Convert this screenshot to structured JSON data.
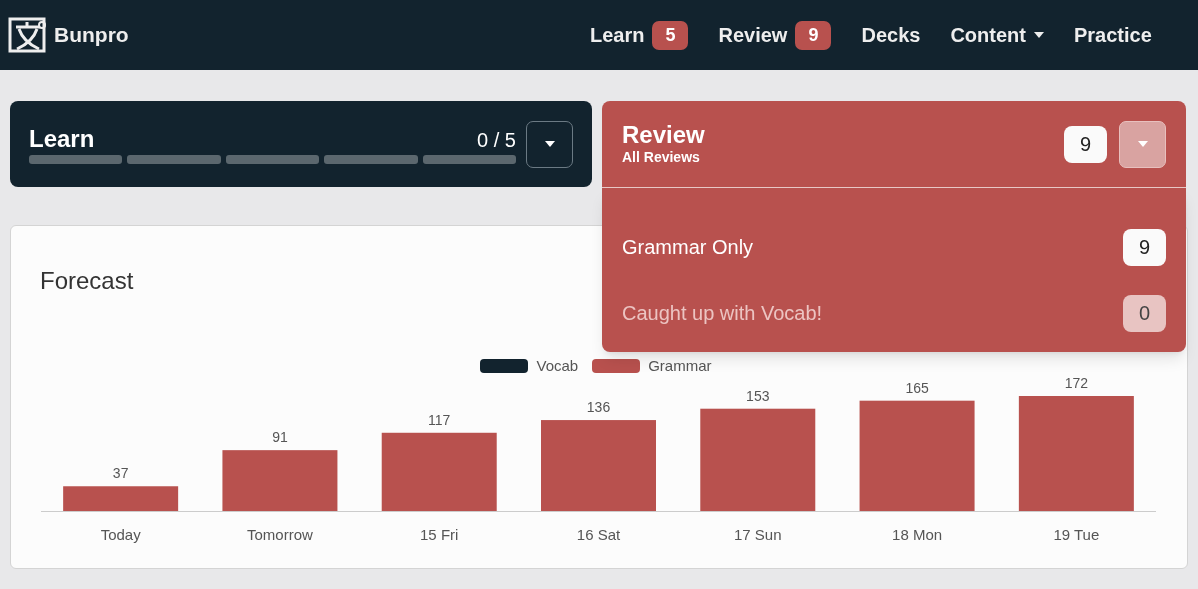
{
  "navbar": {
    "brand": "Bunpro",
    "items": [
      {
        "label": "Learn",
        "badge": "5",
        "kind": "badge"
      },
      {
        "label": "Review",
        "badge": "9",
        "kind": "badge"
      },
      {
        "label": "Decks",
        "kind": "link"
      },
      {
        "label": "Content",
        "kind": "dropdown"
      },
      {
        "label": "Practice",
        "kind": "link"
      }
    ]
  },
  "learn_card": {
    "title": "Learn",
    "progress_text": "0 / 5",
    "segments": [
      {
        "filled": false
      },
      {
        "filled": false
      },
      {
        "filled": false
      },
      {
        "filled": false
      },
      {
        "filled": false
      }
    ]
  },
  "review_card": {
    "title": "Review",
    "subtitle": "All Reviews",
    "count": "9",
    "expanded": true,
    "menu": [
      {
        "label": "Grammar Only",
        "count": "9",
        "disabled": false
      },
      {
        "label": "Caught up with Vocab!",
        "count": "0",
        "disabled": true
      }
    ]
  },
  "forecast": {
    "title": "Forecast",
    "chart_data": {
      "type": "bar",
      "stacked": true,
      "data_labels": true,
      "categories": [
        "Today",
        "Tomorrow",
        "15 Fri",
        "16 Sat",
        "17 Sun",
        "18 Mon",
        "19 Tue"
      ],
      "series": [
        {
          "name": "Vocab",
          "color": "#12232e",
          "values": [
            null,
            null,
            null,
            null,
            null,
            null,
            null
          ]
        },
        {
          "name": "Grammar",
          "color": "#b8514e",
          "values": [
            37,
            91,
            117,
            136,
            153,
            165,
            172
          ]
        }
      ]
    }
  }
}
